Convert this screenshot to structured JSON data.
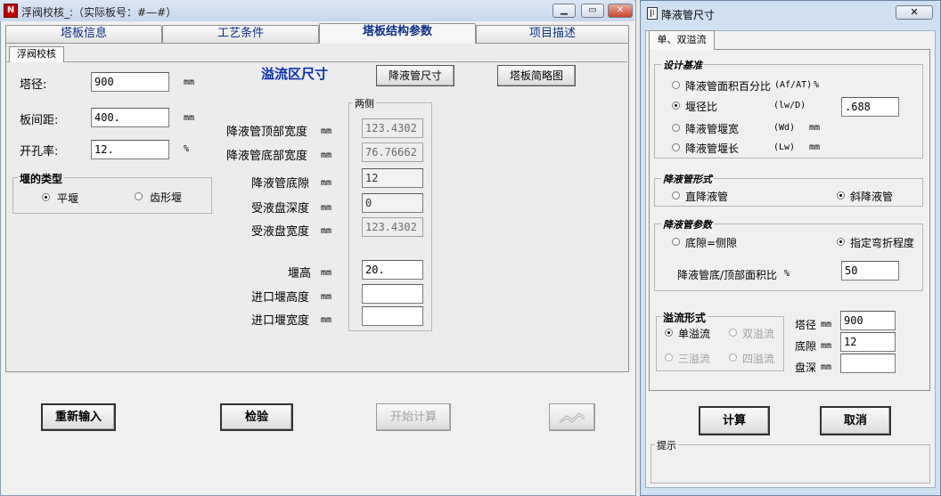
{
  "main": {
    "title": "浮阀校核_:（实际板号：#—#）",
    "app_icon_glyph": "N",
    "tabs": [
      "塔板信息",
      "工艺条件",
      "塔板结构参数",
      "项目描述"
    ],
    "active_tab": "塔板结构参数",
    "subtab": "浮阀校核",
    "left": {
      "diameter_label": "塔径:",
      "diameter_value": "900",
      "diameter_unit": "mm",
      "spacing_label": "板间距:",
      "spacing_value": "400.",
      "spacing_unit": "mm",
      "open_label": "开孔率:",
      "open_value": "12.",
      "open_unit": "%",
      "weir_type_title": "堰的类型",
      "weir_flat": "平堰",
      "weir_serrated": "齿形堰"
    },
    "overflow_heading": "溢流区尺寸",
    "btn_downcomer_size": "降液管尺寸",
    "btn_tray_sketch": "塔板简略图",
    "side_group_title": "两侧",
    "params": [
      {
        "label": "降液管顶部宽度",
        "unit": "mm",
        "value": "123.4302",
        "readonly": true
      },
      {
        "label": "降液管底部宽度",
        "unit": "mm",
        "value": "76.76662",
        "readonly": true
      },
      {
        "label": "降液管底隙",
        "unit": "mm",
        "value": "12",
        "readonly": false
      },
      {
        "label": "受液盘深度",
        "unit": "mm",
        "value": "0",
        "readonly": false
      },
      {
        "label": "受液盘宽度",
        "unit": "mm",
        "value": "123.4302",
        "readonly": true
      }
    ],
    "weir_params": [
      {
        "label": "堰高",
        "unit": "mm",
        "value": "20."
      },
      {
        "label": "进口堰高度",
        "unit": "mm",
        "value": ""
      },
      {
        "label": "进口堰宽度",
        "unit": "mm",
        "value": ""
      }
    ],
    "btn_reinput": "重新输入",
    "btn_check": "检验",
    "btn_start": "开始计算"
  },
  "dialog": {
    "title": "降液管尺寸",
    "close_glyph": "✕",
    "tab": "单、双溢流",
    "basis_title": "设计基准",
    "basis_options": [
      {
        "label": "降液管面积百分比",
        "code": "(Af/AT)",
        "unit": "%",
        "checked": false
      },
      {
        "label": "堰径比",
        "code": "(lw/D)",
        "unit": "",
        "checked": true
      },
      {
        "label": "降液管堰宽",
        "code": "(Wd)",
        "unit": "mm",
        "checked": false
      },
      {
        "label": "降液管堰长",
        "code": "(Lw)",
        "unit": "mm",
        "checked": false
      }
    ],
    "weir_ratio_value": ".688",
    "form_title": "降液管形式",
    "form_straight": "直降液管",
    "form_slanted": "斜降液管",
    "param_title": "降液管参数",
    "param_opt1": "底隙=侧隙",
    "param_opt2": "指定弯折程度",
    "area_ratio_label": "降液管底/顶部面积比",
    "area_ratio_unit": "%",
    "area_ratio_value": "50",
    "flow_title": "溢流形式",
    "flow_single": "单溢流",
    "flow_double": "双溢流",
    "flow_triple": "三溢流",
    "flow_quad": "四溢流",
    "d_label": "塔径",
    "d_unit": "mm",
    "d_value": "900",
    "gap_label": "底隙",
    "gap_unit": "mm",
    "gap_value": "12",
    "depth_label": "盘深",
    "depth_unit": "mm",
    "depth_value": "",
    "btn_calc": "计算",
    "btn_cancel": "取消",
    "hint_title": "提示"
  }
}
